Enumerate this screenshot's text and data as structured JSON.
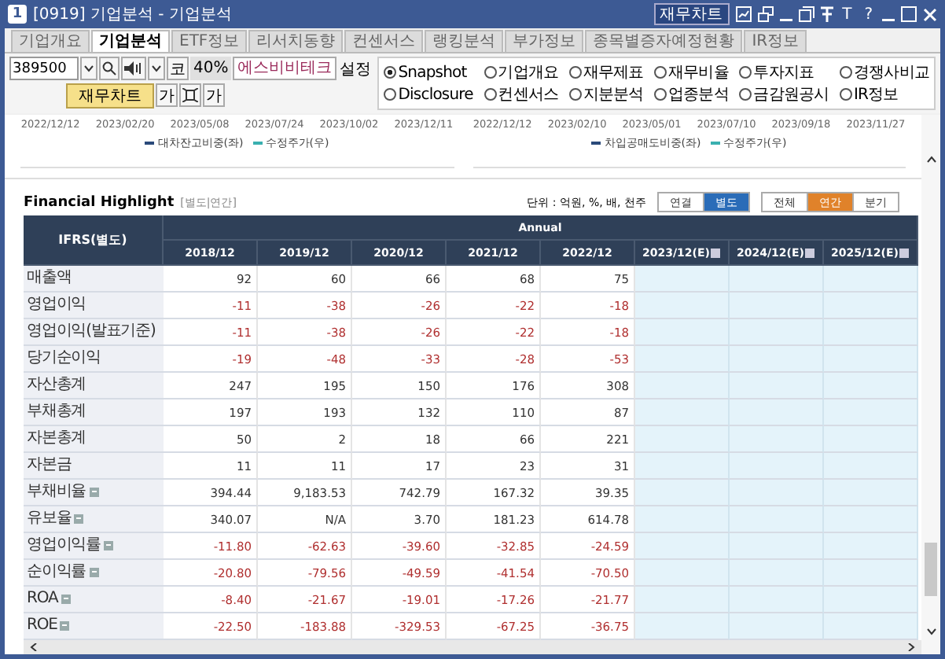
{
  "window": {
    "badge": "1",
    "title": "[0919] 기업분석 - 기업분석",
    "chart_button": "재무차트",
    "text_buttons": [
      "T",
      "?"
    ]
  },
  "tabs": [
    {
      "label": "기업개요",
      "selected": false
    },
    {
      "label": "기업분석",
      "selected": true
    },
    {
      "label": "ETF정보",
      "selected": false
    },
    {
      "label": "리서치동향",
      "selected": false
    },
    {
      "label": "컨센서스",
      "selected": false
    },
    {
      "label": "랭킹분석",
      "selected": false
    },
    {
      "label": "부가정보",
      "selected": false
    },
    {
      "label": "종목별증자예정현황",
      "selected": false
    },
    {
      "label": "IR정보",
      "selected": false
    }
  ],
  "toolbar": {
    "code": "389500",
    "market": "코",
    "ratio": "40%",
    "stock_name": "에스비비테크",
    "settings": "설정",
    "chart_button": "재무차트",
    "font_smaller": "가",
    "font_larger": "가"
  },
  "views": [
    {
      "label": "Snapshot",
      "selected": true
    },
    {
      "label": "기업개요",
      "selected": false
    },
    {
      "label": "재무제표",
      "selected": false
    },
    {
      "label": "재무비율",
      "selected": false
    },
    {
      "label": "투자지표",
      "selected": false
    },
    {
      "label": "경쟁사비교",
      "selected": false
    },
    {
      "label": "Disclosure",
      "selected": false
    },
    {
      "label": "컨센서스",
      "selected": false
    },
    {
      "label": "지분분석",
      "selected": false
    },
    {
      "label": "업종분석",
      "selected": false
    },
    {
      "label": "금감원공시",
      "selected": false
    },
    {
      "label": "IR정보",
      "selected": false
    }
  ],
  "charts": [
    {
      "dates": [
        "2022/12/12",
        "2023/02/20",
        "2023/05/08",
        "2023/07/24",
        "2023/10/02",
        "2023/12/11"
      ],
      "legend": [
        {
          "label": "대차잔고비중(좌)",
          "color": "#2a4a7a"
        },
        {
          "label": "수정주가(우)",
          "color": "#3ab0b0"
        }
      ]
    },
    {
      "dates": [
        "2022/12/12",
        "2023/02/10",
        "2023/05/01",
        "2023/07/10",
        "2023/09/18",
        "2023/11/27"
      ],
      "legend": [
        {
          "label": "차입공매도비중(좌)",
          "color": "#2a4a7a"
        },
        {
          "label": "수정주가(우)",
          "color": "#3ab0b0"
        }
      ]
    }
  ],
  "highlight": {
    "title": "Financial Highlight",
    "subtitle": "[별도|연간]",
    "unit": "단위 : 억원, %, 배, 천주",
    "scope_toggle": [
      {
        "label": "연결",
        "selected": false
      },
      {
        "label": "별도",
        "selected": true
      }
    ],
    "period_toggle": [
      {
        "label": "전체",
        "selected": false
      },
      {
        "label": "연간",
        "selected": true
      },
      {
        "label": "분기",
        "selected": false
      }
    ]
  },
  "table": {
    "corner": "IFRS(별도)",
    "group": "Annual",
    "columns": [
      {
        "label": "2018/12",
        "estimate": false
      },
      {
        "label": "2019/12",
        "estimate": false
      },
      {
        "label": "2020/12",
        "estimate": false
      },
      {
        "label": "2021/12",
        "estimate": false
      },
      {
        "label": "2022/12",
        "estimate": false
      },
      {
        "label": "2023/12(E)",
        "estimate": true
      },
      {
        "label": "2024/12(E)",
        "estimate": true
      },
      {
        "label": "2025/12(E)",
        "estimate": true
      }
    ],
    "rows": [
      {
        "label": "매출액",
        "info": false,
        "negative": false,
        "values": [
          "92",
          "60",
          "66",
          "68",
          "75"
        ]
      },
      {
        "label": "영업이익",
        "info": false,
        "negative": true,
        "values": [
          "-11",
          "-38",
          "-26",
          "-22",
          "-18"
        ]
      },
      {
        "label": "영업이익(발표기준)",
        "info": false,
        "negative": true,
        "values": [
          "-11",
          "-38",
          "-26",
          "-22",
          "-18"
        ]
      },
      {
        "label": "당기순이익",
        "info": false,
        "negative": true,
        "values": [
          "-19",
          "-48",
          "-33",
          "-28",
          "-53"
        ]
      },
      {
        "label": "자산총계",
        "info": false,
        "negative": false,
        "values": [
          "247",
          "195",
          "150",
          "176",
          "308"
        ]
      },
      {
        "label": "부채총계",
        "info": false,
        "negative": false,
        "values": [
          "197",
          "193",
          "132",
          "110",
          "87"
        ]
      },
      {
        "label": "자본총계",
        "info": false,
        "negative": false,
        "values": [
          "50",
          "2",
          "18",
          "66",
          "221"
        ]
      },
      {
        "label": "자본금",
        "info": false,
        "negative": false,
        "values": [
          "11",
          "11",
          "17",
          "23",
          "31"
        ]
      },
      {
        "label": "부채비율",
        "info": true,
        "negative": false,
        "values": [
          "394.44",
          "9,183.53",
          "742.79",
          "167.32",
          "39.35"
        ]
      },
      {
        "label": "유보율",
        "info": true,
        "negative": false,
        "values": [
          "340.07",
          "N/A",
          "3.70",
          "181.23",
          "614.78"
        ]
      },
      {
        "label": "영업이익률",
        "info": true,
        "negative": true,
        "values": [
          "-11.80",
          "-62.63",
          "-39.60",
          "-32.85",
          "-24.59"
        ]
      },
      {
        "label": "순이익률",
        "info": true,
        "negative": true,
        "values": [
          "-20.80",
          "-79.56",
          "-49.59",
          "-41.54",
          "-70.50"
        ]
      },
      {
        "label": "ROA",
        "info": true,
        "negative": true,
        "values": [
          "-8.40",
          "-21.67",
          "-19.01",
          "-17.26",
          "-21.77"
        ]
      },
      {
        "label": "ROE",
        "info": true,
        "negative": true,
        "values": [
          "-22.50",
          "-183.88",
          "-329.53",
          "-67.25",
          "-36.75"
        ]
      }
    ]
  }
}
